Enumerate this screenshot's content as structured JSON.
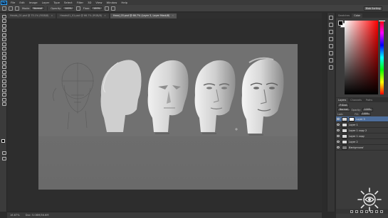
{
  "menubar": {
    "logo": "Ps",
    "items": [
      "File",
      "Edit",
      "Image",
      "Layer",
      "Type",
      "Select",
      "Filter",
      "3D",
      "View",
      "Window",
      "Help"
    ]
  },
  "options": {
    "mode_label": "Mode:",
    "mode_value": "Normal",
    "opacity_label": "Opacity:",
    "opacity_value": "100%",
    "flow_label": "Flow:",
    "flow_value": "100%",
    "workspace": "Blob Sorting"
  },
  "tabs": [
    {
      "label": "Heads_01.psd @ 75.1% (RGB/8)",
      "active": false
    },
    {
      "label": "Heads01_01.psd @ 66.7% (RGB/8)",
      "active": false
    },
    {
      "label": "Head_03.psd @ 66.7% (Layer 3, Layer Mask/8)",
      "active": true
    }
  ],
  "status": {
    "zoom": "16.67%",
    "doc": "Doc: 5.08M/36.6M"
  },
  "color_panel": {
    "tabs": [
      "Swatches",
      "Color"
    ],
    "fg_color": "#000000",
    "bg_color": "#ffffff"
  },
  "layers_panel": {
    "tabs": [
      "Layers",
      "Channels",
      "Paths"
    ],
    "kind_label": "P Kind",
    "blend_mode": "Normal",
    "opacity_label": "Opacity:",
    "opacity_value": "100%",
    "lock_label": "Lock:",
    "fill_label": "Fill:",
    "fill_value": "100%",
    "layers": [
      {
        "name": "Layer 3",
        "selected": true,
        "thumb": "light"
      },
      {
        "name": "Layer 1",
        "selected": false,
        "thumb": "light"
      },
      {
        "name": "Layer 1 copy 2",
        "selected": false,
        "thumb": "light"
      },
      {
        "name": "Layer 1 copy",
        "selected": false,
        "thumb": "light"
      },
      {
        "name": "Layer 2",
        "selected": false,
        "thumb": "light"
      },
      {
        "name": "Background",
        "selected": false,
        "thumb": "bg",
        "italic": true
      }
    ]
  },
  "canvas": {
    "heads": [
      {
        "stage": "sketch"
      },
      {
        "stage": "flat silhouette"
      },
      {
        "stage": "planes"
      },
      {
        "stage": "shading"
      },
      {
        "stage": "refined"
      }
    ]
  }
}
